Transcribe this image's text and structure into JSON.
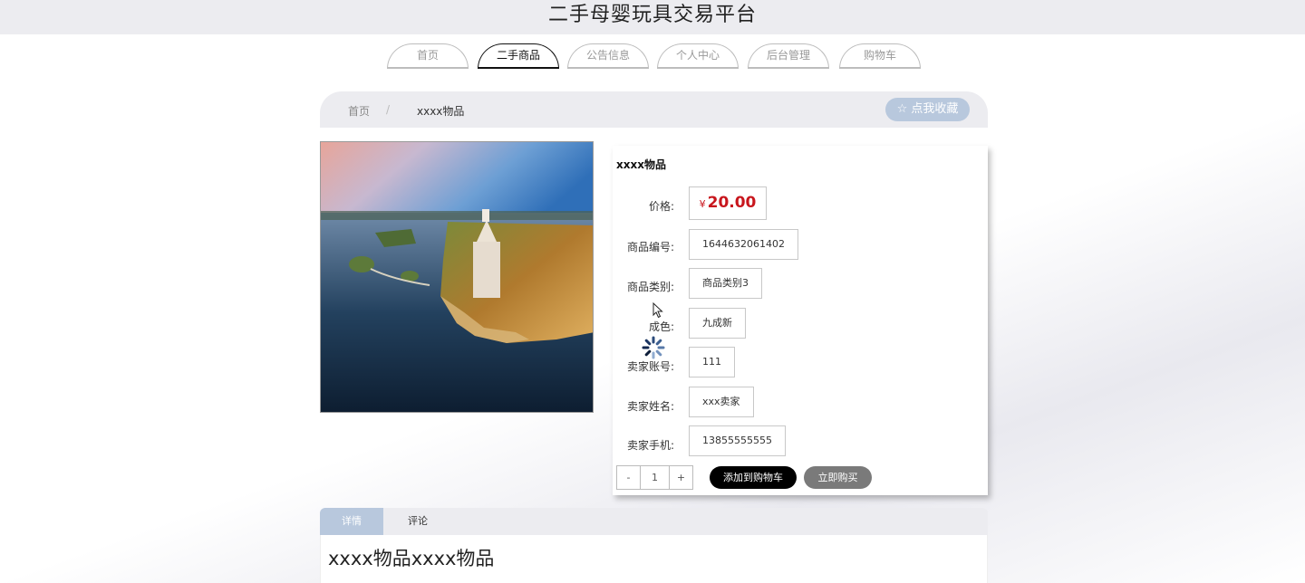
{
  "header": {
    "site_title": "二手母婴玩具交易平台"
  },
  "nav": {
    "tabs": [
      {
        "label": "首页",
        "active": false
      },
      {
        "label": "二手商品",
        "active": true
      },
      {
        "label": "公告信息",
        "active": false
      },
      {
        "label": "个人中心",
        "active": false
      },
      {
        "label": "后台管理",
        "active": false
      },
      {
        "label": "购物车",
        "active": false
      }
    ]
  },
  "breadcrumb": {
    "home": "首页",
    "separator": "/",
    "current": "xxxx物品"
  },
  "favorite_button": {
    "label": "☆ 点我收藏"
  },
  "product": {
    "name": "xxxx物品",
    "price_label": "价格:",
    "currency": "¥",
    "price": "20.00",
    "fields": [
      {
        "label": "商品编号:",
        "value": "1644632061402"
      },
      {
        "label": "商品类别:",
        "value": "商品类别3"
      },
      {
        "label": "成色:",
        "value": "九成新"
      },
      {
        "label": "卖家账号:",
        "value": "111"
      },
      {
        "label": "卖家姓名:",
        "value": "xxx卖家"
      },
      {
        "label": "卖家手机:",
        "value": "13855555555"
      }
    ]
  },
  "quantity": {
    "minus": "-",
    "value": "1",
    "plus": "+"
  },
  "actions": {
    "add_to_cart": "添加到购物车",
    "buy_now": "立即购买"
  },
  "detail": {
    "tabs": [
      {
        "label": "详情",
        "active": true
      },
      {
        "label": "评论",
        "active": false
      }
    ],
    "content": "xxxx物品xxxx物品"
  },
  "colors": {
    "accent": "#b8c8dd",
    "price": "#c8161d",
    "bar": "#ececf0"
  }
}
